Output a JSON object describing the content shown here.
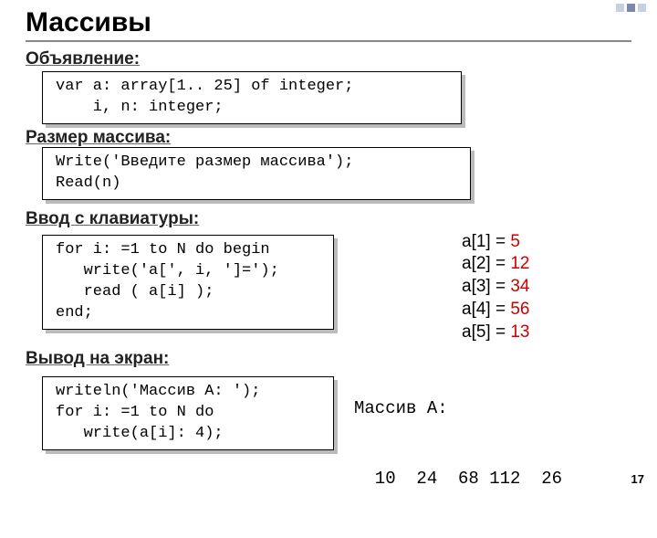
{
  "title": "Массивы",
  "sections": {
    "decl": {
      "label": "Объявление:",
      "code": "var a: array[1.. 25] of integer;\n    i, n: integer;"
    },
    "size": {
      "label": "Размер массива:",
      "code": "Write('Введите размер массива');\nRead(n)"
    },
    "input": {
      "label": "Ввод с клавиатуры:",
      "code": "for i: =1 to N do begin\n   write('a[', i, ']=');\n   read ( a[i] );\nend;"
    },
    "output": {
      "label": "Вывод на экран:",
      "code": "writeln('Массив A: ');\nfor i: =1 to N do\n   write(a[i]: 4);"
    }
  },
  "samples": [
    {
      "k": "a[1] =",
      "v": " 5"
    },
    {
      "k": "a[2] =",
      "v": " 12"
    },
    {
      "k": "a[3] =",
      "v": " 34"
    },
    {
      "k": "a[4] =",
      "v": " 56"
    },
    {
      "k": "a[5] =",
      "v": " 13"
    }
  ],
  "outlines": {
    "l1": "Массив A:",
    "l2": "  10  24  68 112  26"
  },
  "page": "17"
}
